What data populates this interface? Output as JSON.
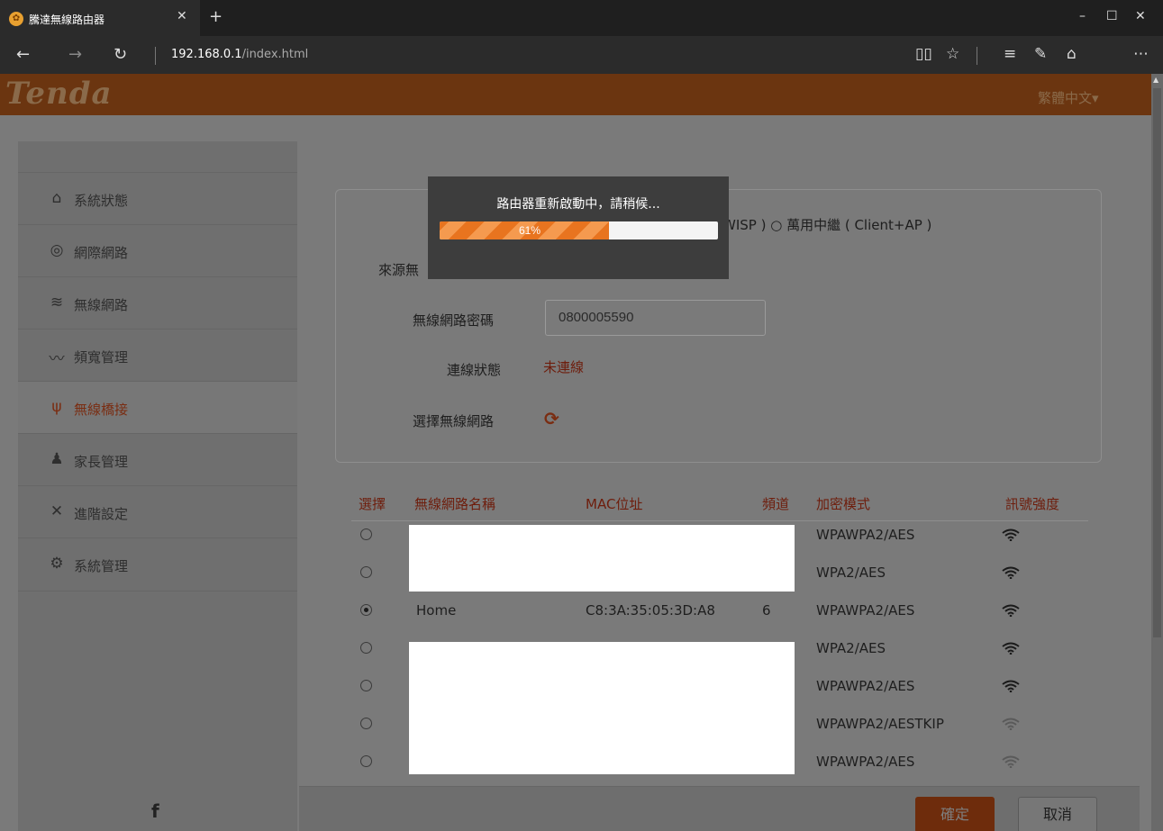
{
  "browser": {
    "tab_title": "騰達無線路由器",
    "tab_close": "✕",
    "new_tab": "+",
    "url_host": "192.168.0.1",
    "url_path": "/index.html",
    "win_min": "–",
    "win_max": "☐",
    "win_close": "✕"
  },
  "header": {
    "logo": "Tenda",
    "language": "繁體中文▾"
  },
  "sidebar": {
    "items": [
      {
        "label": "系統狀態",
        "icon": "router-icon"
      },
      {
        "label": "網際網路",
        "icon": "globe-icon"
      },
      {
        "label": "無線網路",
        "icon": "wifi-icon"
      },
      {
        "label": "頻寬管理",
        "icon": "bandwidth-icon"
      },
      {
        "label": "無線橋接",
        "icon": "antenna-icon"
      },
      {
        "label": "家長管理",
        "icon": "parent-icon"
      },
      {
        "label": "進階設定",
        "icon": "tools-icon"
      },
      {
        "label": "系統管理",
        "icon": "gear-icon"
      }
    ],
    "active_index": 4,
    "footer_icon": "f"
  },
  "form": {
    "mode_tail": "WISP ) ○ 萬用中繼 ( Client+AP )",
    "source_label": "來源無",
    "password_label": "無線網路密碼",
    "password_value": "0800005590",
    "status_label": "連線狀態",
    "status_value": "未連線",
    "select_label": "選擇無線網路",
    "refresh_glyph": "⟳"
  },
  "table": {
    "headers": [
      "選擇",
      "無線網路名稱",
      "MAC位址",
      "頻道",
      "加密模式",
      "訊號強度"
    ],
    "rows": [
      {
        "selected": false,
        "name": "",
        "mac": "",
        "channel": "",
        "security": "WPAWPA2/AES",
        "signal": "strong"
      },
      {
        "selected": false,
        "name": "",
        "mac": "",
        "channel": "",
        "security": "WPA2/AES",
        "signal": "strong"
      },
      {
        "selected": true,
        "name": "Home",
        "mac": "C8:3A:35:05:3D:A8",
        "channel": "6",
        "security": "WPAWPA2/AES",
        "signal": "strong"
      },
      {
        "selected": false,
        "name": "",
        "mac": "",
        "channel": "",
        "security": "WPA2/AES",
        "signal": "strong"
      },
      {
        "selected": false,
        "name": "",
        "mac": "",
        "channel": "",
        "security": "WPAWPA2/AES",
        "signal": "strong"
      },
      {
        "selected": false,
        "name": "",
        "mac": "",
        "channel": "",
        "security": "WPAWPA2/AESTKIP",
        "signal": "weak"
      },
      {
        "selected": false,
        "name": "",
        "mac": "",
        "channel": "",
        "security": "WPAWPA2/AES",
        "signal": "weak"
      }
    ]
  },
  "buttons": {
    "ok": "確定",
    "cancel": "取消"
  },
  "modal": {
    "title": "路由器重新啟動中，請稍候...",
    "progress_text": "61%",
    "progress_fraction": 0.61
  },
  "colors": {
    "accent": "#e8741f",
    "header": "#6b3510"
  }
}
